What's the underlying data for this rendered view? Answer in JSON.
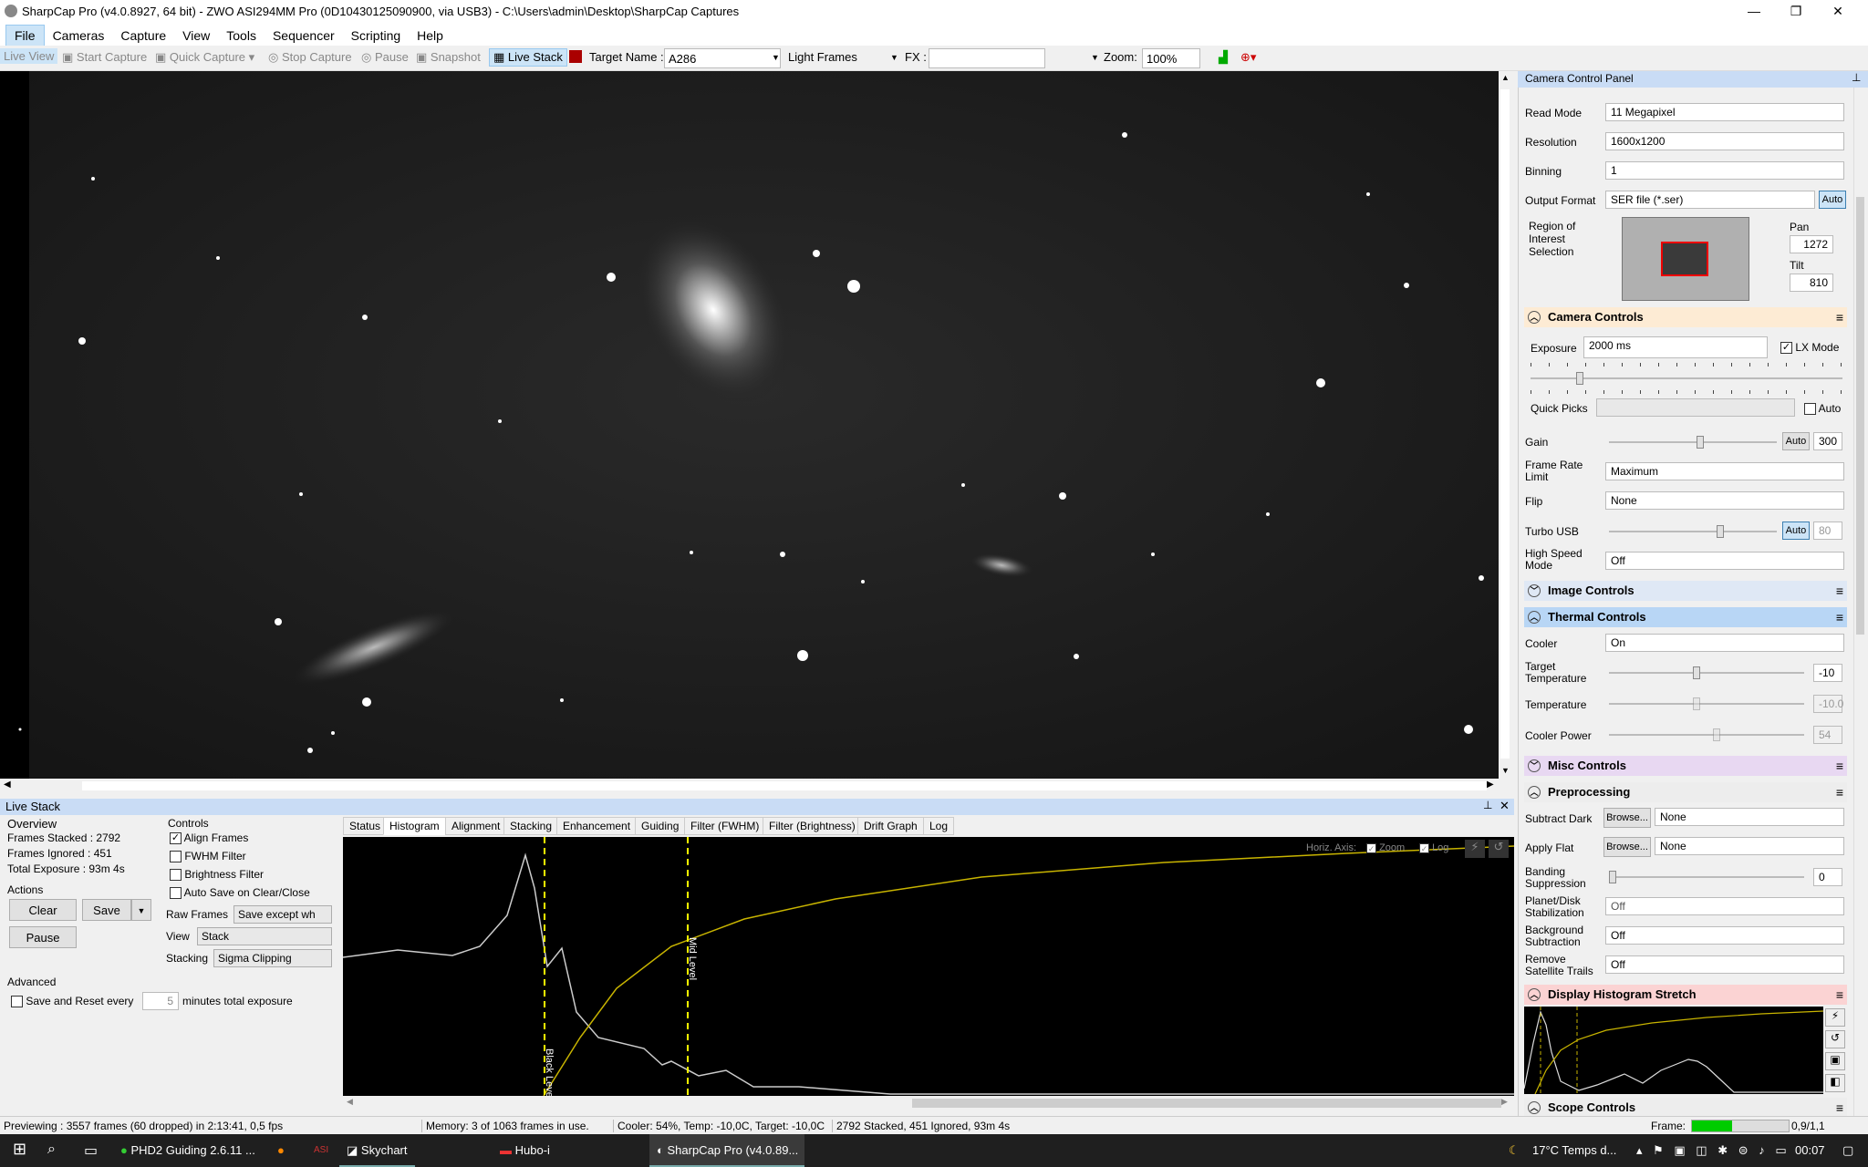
{
  "window": {
    "title": "SharpCap Pro (v4.0.8927, 64 bit) - ZWO ASI294MM Pro (0D10430125090900, via USB3) - C:\\Users\\admin\\Desktop\\SharpCap Captures"
  },
  "menu": [
    "File",
    "Cameras",
    "Capture",
    "View",
    "Tools",
    "Sequencer",
    "Scripting",
    "Help"
  ],
  "toolbar": {
    "live_view": "Live View",
    "start_capture": "Start Capture",
    "quick_capture": "Quick Capture",
    "stop_capture": "Stop Capture",
    "pause": "Pause",
    "snapshot": "Snapshot",
    "live_stack": "Live Stack",
    "target_label": "Target Name :",
    "target_value": "A286",
    "frame_type": "Light Frames",
    "fx_label": "FX :",
    "zoom_label": "Zoom:",
    "zoom_value": "100%"
  },
  "livestack": {
    "title": "Live Stack",
    "overview": "Overview",
    "frames_stacked": "Frames Stacked : 2792",
    "frames_ignored": "Frames Ignored :   451",
    "total_exposure": "Total Exposure :  93m 4s",
    "actions": "Actions",
    "clear": "Clear",
    "save": "Save",
    "pause": "Pause",
    "advanced": "Advanced",
    "save_reset": "Save and Reset every",
    "save_reset_value": "5",
    "save_reset_suffix": "minutes total exposure",
    "controls": "Controls",
    "align_frames": "Align Frames",
    "fwhm_filter": "FWHM Filter",
    "brightness_filter": "Brightness Filter",
    "auto_save": "Auto Save on Clear/Close",
    "raw_frames_label": "Raw Frames",
    "raw_frames_value": "Save except wh",
    "view_label": "View",
    "view_value": "Stack",
    "stacking_label": "Stacking",
    "stacking_value": "Sigma Clipping",
    "tabs": [
      "Status",
      "Histogram",
      "Alignment",
      "Stacking",
      "Enhancement",
      "Guiding",
      "Filter (FWHM)",
      "Filter (Brightness)",
      "Drift Graph",
      "Log"
    ],
    "horiz_axis": "Horiz. Axis:",
    "zoom": "Zoom",
    "log": "Log",
    "black_level": "Black Level",
    "mid_level": "Mid Level"
  },
  "ccp": {
    "title": "Camera Control Panel",
    "read_mode_label": "Read Mode",
    "read_mode": "11 Megapixel",
    "resolution_label": "Resolution",
    "resolution": "1600x1200",
    "binning_label": "Binning",
    "binning": "1",
    "output_label": "Output Format",
    "output": "SER file (*.ser)",
    "auto": "Auto",
    "roi_label": "Region of Interest Selection",
    "pan_label": "Pan",
    "pan": "1272",
    "tilt_label": "Tilt",
    "tilt": "810",
    "camera_controls": "Camera Controls",
    "exposure_label": "Exposure",
    "exposure": "2000 ms",
    "lx_mode": "LX Mode",
    "quick_picks": "Quick Picks",
    "auto2": "Auto",
    "gain_label": "Gain",
    "gain": "300",
    "frame_rate_label": "Frame Rate Limit",
    "frame_rate": "Maximum",
    "flip_label": "Flip",
    "flip": "None",
    "turbo_label": "Turbo USB",
    "turbo": "80",
    "hsm_label": "High Speed Mode",
    "hsm": "Off",
    "image_controls": "Image Controls",
    "thermal_controls": "Thermal Controls",
    "cooler_label": "Cooler",
    "cooler": "On",
    "target_temp_label": "Target Temperature",
    "target_temp": "-10",
    "temp_label": "Temperature",
    "temp": "-10.0",
    "cooler_power_label": "Cooler Power",
    "cooler_power": "54",
    "misc_controls": "Misc Controls",
    "preprocessing": "Preprocessing",
    "subtract_dark": "Subtract Dark",
    "browse": "Browse...",
    "none": "None",
    "apply_flat": "Apply Flat",
    "banding_label": "Banding Suppression",
    "banding": "0",
    "planet_label": "Planet/Disk Stabilization",
    "off": "Off",
    "bg_label": "Background Subtraction",
    "sat_label": "Remove Satellite Trails",
    "display_hist": "Display Histogram Stretch",
    "scope_controls": "Scope Controls"
  },
  "status": {
    "previewing": "Previewing : 3557 frames (60 dropped) in 2:13:41, 0,5 fps",
    "memory": "Memory: 3 of 1063 frames in use.",
    "cooler": "Cooler: 54%, Temp: -10,0C, Target: -10,0C",
    "stacked": "2792 Stacked, 451 Ignored, 93m 4s",
    "frame_label": "Frame:",
    "frame_value": "0,9/1,1"
  },
  "taskbar": {
    "items": [
      "PHD2 Guiding 2.6.11 ...",
      "Skychart",
      "Hubo-i",
      "SharpCap Pro (v4.0.89..."
    ],
    "weather": "17°C  Temps d...",
    "time": "00:07"
  }
}
